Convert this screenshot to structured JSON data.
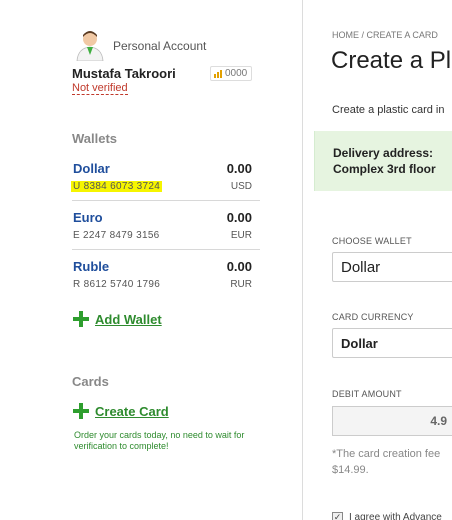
{
  "account": {
    "label": "Personal Account",
    "name": "Mustafa Takroori",
    "status": "Not verified",
    "rating": "0000"
  },
  "wallets": {
    "title": "Wallets",
    "items": [
      {
        "name": "Dollar",
        "number": "U 8384 6073 3724",
        "balance": "0.00",
        "currency": "USD",
        "highlighted": true
      },
      {
        "name": "Euro",
        "number": "E 2247 8479 3156",
        "balance": "0.00",
        "currency": "EUR"
      },
      {
        "name": "Ruble",
        "number": "R 8612 5740 1796",
        "balance": "0.00",
        "currency": "RUR"
      }
    ],
    "add_label": "Add Wallet"
  },
  "cards": {
    "title": "Cards",
    "create_label": "Create Card",
    "note": "Order your cards today, no need to wait for verification to complete!"
  },
  "main": {
    "breadcrumb": "HOME / CREATE A CARD",
    "title": "Create a Pl",
    "intro": "Create a plastic card in",
    "delivery_line1": "Delivery address:",
    "delivery_line2": "Complex 3rd floor",
    "choose_wallet_label": "CHOOSE WALLET",
    "choose_wallet_value": "Dollar",
    "card_currency_label": "CARD CURRENCY",
    "card_currency_value": "Dollar",
    "debit_amount_label": "DEBIT AMOUNT",
    "debit_amount_value": "4.9",
    "fee_line1": "*The card creation fee",
    "fee_line2": "$14.99.",
    "agree_text": "I agree with Advance",
    "agree_mark": "✓"
  },
  "colors": {
    "link_blue": "#1f4e9c",
    "green": "#2e8b2e",
    "highlight": "#f6f500",
    "delivery_bg": "#e6f4e0"
  }
}
